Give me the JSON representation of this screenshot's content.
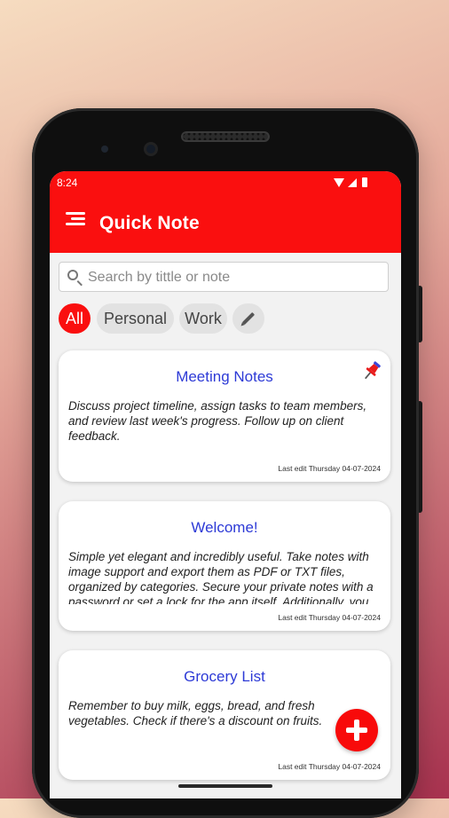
{
  "status": {
    "time": "8:24"
  },
  "app": {
    "title": "Quick Note"
  },
  "search": {
    "placeholder": "Search by tittle or note"
  },
  "filters": [
    {
      "label": "All",
      "active": true
    },
    {
      "label": "Personal",
      "active": false
    },
    {
      "label": "Work",
      "active": false
    }
  ],
  "notes": [
    {
      "title": "Meeting Notes",
      "body": "Discuss project timeline, assign tasks to team members, and review last week's progress. Follow up on client feedback.",
      "last_edit": "Last edit Thursday 04-07-2024",
      "pinned": true
    },
    {
      "title": "Welcome!",
      "body": "Simple yet elegant and incredibly useful. Take notes with image support and export them as PDF or TXT files, organized by categories. Secure your private notes with a password or set a lock for the app itself. Additionally, you",
      "last_edit": "Last edit Thursday 04-07-2024",
      "pinned": false
    },
    {
      "title": "Grocery List",
      "body": "Remember to buy milk, eggs, bread, and fresh vegetables. Check if there's a discount on fruits.",
      "last_edit": "Last edit Thursday 04-07-2024",
      "pinned": false
    }
  ],
  "colors": {
    "accent": "#fa0f0f",
    "title_blue": "#2d3ad6"
  },
  "icons": [
    "menu-icon",
    "search-icon",
    "edit-pencil-icon",
    "pin-icon",
    "add-icon"
  ]
}
